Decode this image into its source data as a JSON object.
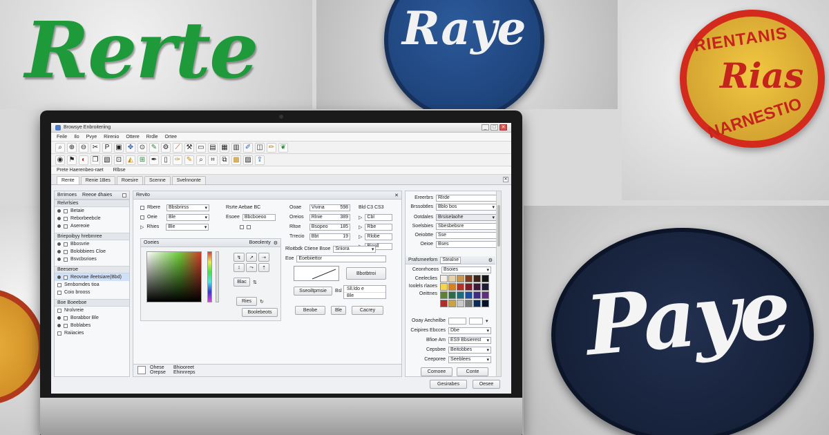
{
  "background": {
    "patch_green": "Rerte",
    "patch_blue": "Raye",
    "patch_red": {
      "top": "RIENTANIS",
      "middle": "Rias",
      "bottom": "NARNESTIO"
    },
    "patch_navy": "Paye"
  },
  "colors": {
    "green_thread": "#1f9a3a",
    "blue_patch": "#1f477f",
    "red_thread": "#d42a1e",
    "navy_patch": "#152038",
    "accent": "#cfe0f7"
  },
  "window": {
    "title": "Browsye Enbroiteriing",
    "controls": [
      "_",
      "□",
      "✕"
    ],
    "menu": [
      "Feile",
      "Ilo",
      "Pvye",
      "Rirenio",
      "Ottere",
      "Rrdle",
      "Ortee"
    ],
    "breadcrumb": [
      "Prete Haerenbeo-raet",
      "Rlbse"
    ]
  },
  "toolbar": {
    "row1_icons": [
      "search-icon",
      "zoom-icon",
      "zoom-out-icon",
      "cut-icon",
      "text-icon",
      "paste-icon",
      "pan-icon",
      "magnify-icon",
      "pen-icon",
      "gear-icon",
      "needle-icon",
      "wrench-icon",
      "eraser-icon",
      "doc-icon",
      "picture-icon",
      "clipboard-icon",
      "brush-icon",
      "image-icon",
      "pencil-icon",
      "leaf-icon"
    ],
    "row2_icons": [
      "stamp-icon",
      "flag-icon",
      "palette-icon",
      "copy-icon",
      "folder-icon",
      "lock-icon",
      "bucket-icon",
      "file-icon",
      "pencil-icon",
      "ruler-icon",
      "marker-icon",
      "crayon-icon",
      "search-icon",
      "crop-icon",
      "frame-icon",
      "chart-icon",
      "gallery-icon",
      "export-icon"
    ]
  },
  "tabs": [
    "Rente",
    "Renie 1Bes",
    "Roesire",
    "Scenne",
    "Svelnnonte"
  ],
  "left_panel": {
    "header": [
      "Brrimoes",
      "Reeoe dhaies"
    ],
    "sections": [
      {
        "title": "Relvrlsies",
        "items": [
          "Betaie",
          "Reborbeebcle",
          "Asereoie"
        ]
      },
      {
        "title": "Briepoibyy hrebmree",
        "items": [
          "Bbosvrie",
          "Bolobbiees Cloe",
          "Bsvcbsrioes"
        ]
      },
      {
        "title": "Beeseroe",
        "items": [
          "Reovrae ifeetsiare(Bbd)",
          "Senbomdes tioa",
          "Coio brooss"
        ]
      },
      {
        "title": "Boe Boeeboe",
        "items": [
          "Nrolvreie",
          "Borabbor Ble",
          "Boblabes",
          "Raiiacies"
        ]
      }
    ]
  },
  "center": {
    "header": "Revito",
    "col1": [
      {
        "label": "Rbere",
        "value": "Bbsbrirss"
      },
      {
        "label": "Oeie",
        "value": "Ble"
      },
      {
        "label": "Rhies",
        "value": "Ble"
      }
    ],
    "col1_extra": {
      "label_a": "Rsrte Aebae BC",
      "label_b": "Esoee",
      "value_b": "Bbcboeoo"
    },
    "col2": [
      {
        "label": "Ooae",
        "value": "Vivina",
        "num": "598"
      },
      {
        "label": "Oreios",
        "value": "Rlnie",
        "num": "389"
      },
      {
        "label": "Rltoe",
        "value": "Bsopeo",
        "num": "185"
      },
      {
        "label": "Trrecio",
        "value": "Bbt",
        "num": "19"
      }
    ],
    "col3_title": "Bld C3 CS3",
    "col3": [
      "Cbl",
      "Rbe",
      "Rlobe",
      "Biooll"
    ],
    "color_box": {
      "header": "Ooeies",
      "header_right": "Boeolenty",
      "buttons": [
        "Blac",
        "Ries",
        "Boolebeots"
      ]
    },
    "stitch_box": {
      "title": "Rloitbdk Ctiene Bsoe",
      "select": "Sriiora",
      "field_label": "Eoe",
      "field_value": "Eoebiiettor",
      "button_right": "Bbotbtroi",
      "button_left": "Sseoiltpmsie",
      "side_label": "Bsl",
      "list": [
        "Sll.ldo e",
        "Ble"
      ],
      "bottom_buttons": [
        "Beobe",
        "Ble",
        "Cacrey"
      ]
    }
  },
  "right_panel": {
    "top": [
      {
        "label": "Ereerbrs",
        "value": "Rlrde"
      },
      {
        "label": "Brssobtles",
        "value": "Bblo bos"
      },
      {
        "label": "Ootdales",
        "value": "Brsiselaohe"
      },
      {
        "label": "Soelsbies",
        "value": "Sbesbebsre"
      },
      {
        "label": "Oeiobtte",
        "value": "Sse"
      },
      {
        "label": "Oeioe",
        "value": "Bses"
      }
    ],
    "palette_header": [
      "Prafsrneeforn",
      "Stealne"
    ],
    "palette_labels": [
      "Ceonrhoeos",
      "Ceeleclies",
      "Ioolels rlaoes",
      "Oeittnes"
    ],
    "palette_value": "Bsoies",
    "bottom": [
      {
        "label": "Ooay Aecheilbe",
        "value": ""
      },
      {
        "label": "Ceipires Ebcces",
        "value": "Dbe"
      },
      {
        "label": "Bfioe Am",
        "value": "ES9 Bbsierest"
      },
      {
        "label": "Cepsbee",
        "value": "Beitobbes"
      },
      {
        "label": "Ceeporee",
        "value": "Seeblees"
      }
    ],
    "buttons": [
      "Comoee",
      "Conte"
    ]
  },
  "status": {
    "left": [
      "Ohese",
      "Orepse"
    ],
    "right": [
      "Bhiooreet",
      "Ehinnreps"
    ],
    "buttons": [
      "Gesirabes",
      "Oesee"
    ]
  },
  "swatches": [
    "#f4efe6",
    "#e7d1a8",
    "#c7964f",
    "#7a3b1f",
    "#3a2418",
    "#161616",
    "#f7d54a",
    "#d9801f",
    "#b13328",
    "#7e1c2a",
    "#3d1838",
    "#1d1d33",
    "#5f7f3b",
    "#2e6d45",
    "#1d6d7e",
    "#1e4f9e",
    "#412c85",
    "#5f2f7c",
    "#ad2e2a",
    "#c8a542",
    "#c9c9c9",
    "#7a7a7a",
    "#0c2b5a",
    "#05122a"
  ]
}
